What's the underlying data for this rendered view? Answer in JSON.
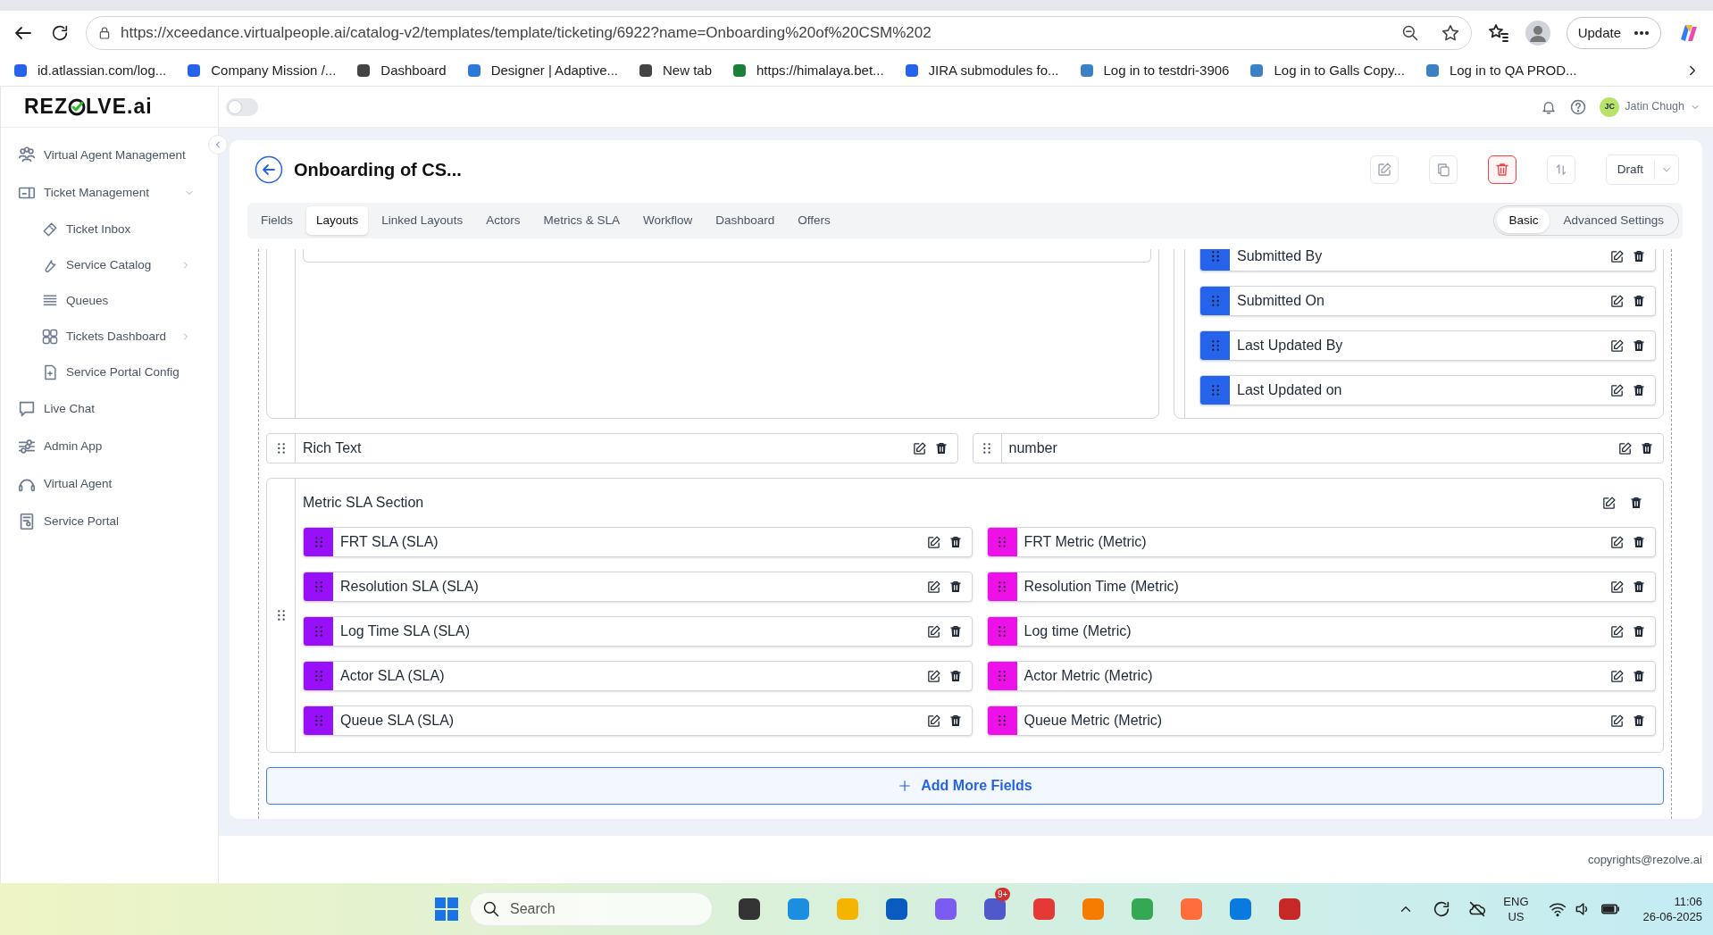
{
  "browser": {
    "url": "https://xceedance.virtualpeople.ai/catalog-v2/templates/template/ticketing/6922?name=Onboarding%20of%20CSM%202",
    "update_label": "Update",
    "bookmarks": [
      {
        "label": "id.atlassian.com/log..."
      },
      {
        "label": "Company Mission /..."
      },
      {
        "label": "Dashboard"
      },
      {
        "label": "Designer | Adaptive..."
      },
      {
        "label": "New tab"
      },
      {
        "label": "https://himalaya.bet..."
      },
      {
        "label": "JIRA submodules fo..."
      },
      {
        "label": "Log in to testdri-3906"
      },
      {
        "label": "Log in to Galls Copy..."
      },
      {
        "label": "Log in to QA PROD..."
      }
    ]
  },
  "app": {
    "logo_left": "REZ",
    "logo_right": "LVE.ai",
    "theme_toggle": {
      "on": false
    },
    "user": {
      "initials": "JC",
      "name": "Jatin Chugh"
    },
    "sidebar": {
      "items": [
        {
          "label": "Virtual Agent Management"
        },
        {
          "label": "Ticket Management",
          "expanded": true,
          "children": [
            {
              "label": "Ticket Inbox"
            },
            {
              "label": "Service Catalog",
              "has_submenu": true
            },
            {
              "label": "Queues"
            },
            {
              "label": "Tickets Dashboard",
              "has_submenu": true
            },
            {
              "label": "Service Portal Config"
            }
          ]
        },
        {
          "label": "Live Chat"
        },
        {
          "label": "Admin App"
        },
        {
          "label": "Virtual Agent"
        },
        {
          "label": "Service Portal"
        }
      ]
    },
    "page": {
      "title": "Onboarding of CS...",
      "status": "Draft",
      "tabs": [
        {
          "label": "Fields",
          "selected": false
        },
        {
          "label": "Layouts",
          "selected": true
        },
        {
          "label": "Linked Layouts",
          "selected": false
        },
        {
          "label": "Actors",
          "selected": false
        },
        {
          "label": "Metrics & SLA",
          "selected": false
        },
        {
          "label": "Workflow",
          "selected": false
        },
        {
          "label": "Dashboard",
          "selected": false
        },
        {
          "label": "Offers",
          "selected": false
        }
      ],
      "modes": [
        {
          "label": "Basic",
          "selected": true
        },
        {
          "label": "Advanced Settings",
          "selected": false
        }
      ],
      "right_panel_fields": [
        {
          "label": "Submitted By",
          "color": "#2563eb"
        },
        {
          "label": "Submitted On",
          "color": "#2563eb"
        },
        {
          "label": "Last Updated By",
          "color": "#2563eb"
        },
        {
          "label": "Last Updated on",
          "color": "#2563eb"
        }
      ],
      "standalone_fields": [
        {
          "label": "Rich Text"
        },
        {
          "label": "number"
        }
      ],
      "section": {
        "title": "Metric SLA Section",
        "left_fields": [
          {
            "label": "FRT SLA (SLA)",
            "color": "#9810fa"
          },
          {
            "label": "Resolution SLA (SLA)",
            "color": "#9810fa"
          },
          {
            "label": "Log Time SLA (SLA)",
            "color": "#9810fa"
          },
          {
            "label": "Actor SLA (SLA)",
            "color": "#9810fa"
          },
          {
            "label": "Queue SLA (SLA)",
            "color": "#9810fa"
          }
        ],
        "right_fields": [
          {
            "label": "FRT Metric (Metric)",
            "color": "#ee10e8"
          },
          {
            "label": "Resolution Time (Metric)",
            "color": "#ee10e8"
          },
          {
            "label": "Log time (Metric)",
            "color": "#ee10e8"
          },
          {
            "label": "Actor Metric (Metric)",
            "color": "#ee10e8"
          },
          {
            "label": "Queue Metric (Metric)",
            "color": "#ee10e8"
          }
        ]
      },
      "add_button": "Add More Fields"
    },
    "footer": "copyrights@rezolve.ai"
  },
  "taskbar": {
    "search_placeholder": "Search",
    "badge": "9+",
    "language": "ENG",
    "region": "US",
    "time": "11:06",
    "date": "26-06-2025"
  }
}
